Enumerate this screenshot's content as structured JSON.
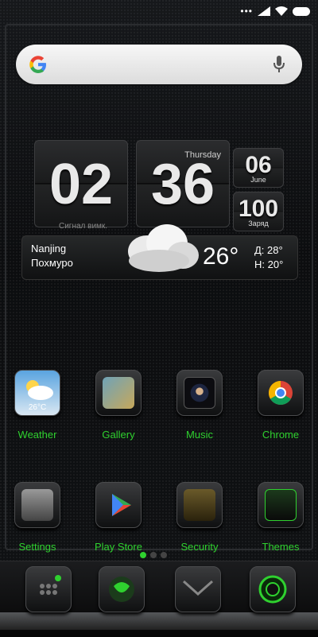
{
  "search": {
    "placeholder": ""
  },
  "clock": {
    "hour": "02",
    "minute": "36",
    "day_name": "Thursday",
    "signal_text": "Сигнал вимк.",
    "date_number": "06",
    "month": "June",
    "battery_percent": "100",
    "battery_label": "Заряд"
  },
  "weather": {
    "city": "Nanjing",
    "condition": "Похмуро",
    "temperature": "26°",
    "high": "Д: 28°",
    "low": "Н: 20°"
  },
  "apps": [
    {
      "label": "Weather",
      "icon": "weather-icon"
    },
    {
      "label": "Gallery",
      "icon": "gallery-icon"
    },
    {
      "label": "Music",
      "icon": "music-icon"
    },
    {
      "label": "Chrome",
      "icon": "chrome-icon"
    },
    {
      "label": "Settings",
      "icon": "settings-icon"
    },
    {
      "label": "Play Store",
      "icon": "play-store-icon"
    },
    {
      "label": "Security",
      "icon": "security-icon"
    },
    {
      "label": "Themes",
      "icon": "themes-icon"
    }
  ],
  "weather_icon_temp": "26°C",
  "accent_color": "#2fd12f",
  "dock": [
    "phone-icon",
    "messages-icon",
    "email-icon",
    "camera-icon"
  ]
}
